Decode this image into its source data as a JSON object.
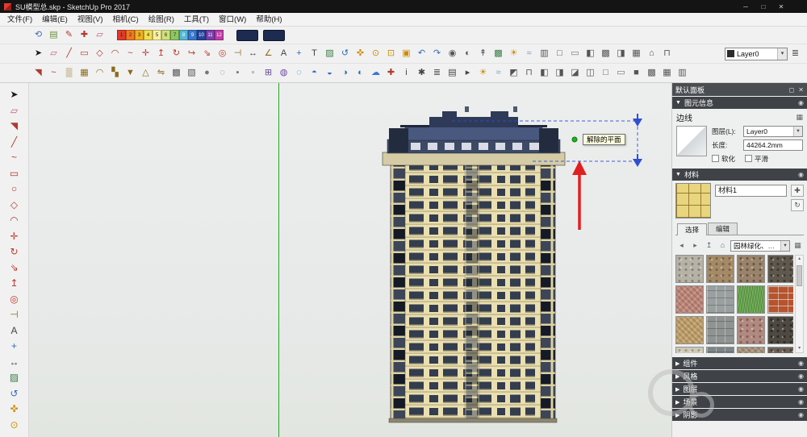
{
  "window": {
    "title": "SU模型总.skp - SketchUp Pro 2017",
    "controls": {
      "min": "─",
      "max": "□",
      "close": "✕"
    }
  },
  "menu": {
    "items": [
      "文件(F)",
      "编辑(E)",
      "视图(V)",
      "相机(C)",
      "绘图(R)",
      "工具(T)",
      "窗口(W)",
      "帮助(H)"
    ]
  },
  "glyphs": {
    "tri_open": "▼",
    "tri_closed": "▶",
    "pin": "◉",
    "float": "◻",
    "close_small": "✕",
    "dd_arrow": "▾",
    "scroll_up": "▴",
    "scroll_down": "▾",
    "entity_btn": "▦"
  },
  "toolbars": {
    "row1": {
      "icons": [
        {
          "n": "camera-orbit-icon",
          "g": "⟲",
          "c": "#3a6fb0"
        },
        {
          "n": "image-export-icon",
          "g": "▤",
          "c": "#6a8f3a"
        },
        {
          "n": "curve-edit-icon",
          "g": "✎",
          "c": "#b03a2e"
        },
        {
          "n": "add-scene-icon",
          "g": "✚",
          "c": "#b03a2e"
        },
        {
          "n": "eraser-icon",
          "g": "▱",
          "c": "#c05a7a"
        }
      ],
      "palette": {
        "numbers": [
          "1",
          "2",
          "3",
          "4",
          "5",
          "6",
          "7",
          "8",
          "9",
          "10",
          "11",
          "12"
        ],
        "colors": [
          "#e03a2a",
          "#f07820",
          "#f0b020",
          "#f4de4e",
          "#f8f0a0",
          "#cfe07a",
          "#8cc860",
          "#53b8d8",
          "#3a78d0",
          "#27459c",
          "#7a3fb0",
          "#c23ba8"
        ]
      },
      "displays": [
        {
          "n": "timeline-display-a"
        },
        {
          "n": "timeline-display-b"
        }
      ]
    },
    "row2": {
      "icons": [
        {
          "n": "select-tool",
          "g": "➤",
          "c": "#1a1a1a"
        },
        {
          "n": "eraser-tool",
          "g": "▱",
          "c": "#c05a7a"
        },
        {
          "n": "line-tool",
          "g": "╱",
          "c": "#b03a2e"
        },
        {
          "n": "rectangle-tool",
          "g": "▭",
          "c": "#b03a2e"
        },
        {
          "n": "shapes-tool",
          "g": "◇",
          "c": "#b03a2e"
        },
        {
          "n": "arc-tool",
          "g": "◠",
          "c": "#b03a2e"
        },
        {
          "n": "freehand-tool",
          "g": "~",
          "c": "#b03a2e"
        },
        {
          "n": "move-tool",
          "g": "✛",
          "c": "#c0392b"
        },
        {
          "n": "push-pull-tool",
          "g": "↥",
          "c": "#c0392b"
        },
        {
          "n": "rotate-tool",
          "g": "↻",
          "c": "#c0392b"
        },
        {
          "n": "follow-me-tool",
          "g": "↪",
          "c": "#c0392b"
        },
        {
          "n": "scale-tool",
          "g": "⇘",
          "c": "#c0392b"
        },
        {
          "n": "offset-tool",
          "g": "◎",
          "c": "#c0392b"
        },
        {
          "n": "tape-measure-tool",
          "g": "⊣",
          "c": "#8a6d1a"
        },
        {
          "n": "dimension-tool",
          "g": "↔",
          "c": "#444444"
        },
        {
          "n": "protractor-tool",
          "g": "∠",
          "c": "#8a6d1a"
        },
        {
          "n": "text-tool",
          "g": "A",
          "c": "#444444"
        },
        {
          "n": "axes-tool",
          "g": "+",
          "c": "#2e6fbd"
        },
        {
          "n": "3d-text-tool",
          "g": "T",
          "c": "#444444"
        },
        {
          "n": "section-plane-tool",
          "g": "▨",
          "c": "#3a7d44"
        },
        {
          "n": "orbit-tool",
          "g": "↺",
          "c": "#2e6fbd"
        },
        {
          "n": "pan-tool",
          "g": "✜",
          "c": "#d08a00"
        },
        {
          "n": "zoom-tool",
          "g": "⊙",
          "c": "#d08a00"
        },
        {
          "n": "zoom-window-tool",
          "g": "⊡",
          "c": "#d08a00"
        },
        {
          "n": "zoom-extents-tool",
          "g": "▣",
          "c": "#d08a00"
        },
        {
          "n": "previous-view-icon",
          "g": "↶",
          "c": "#2e6fbd"
        },
        {
          "n": "next-view-icon",
          "g": "↷",
          "c": "#2e6fbd"
        },
        {
          "n": "position-camera-tool",
          "g": "◉",
          "c": "#555555"
        },
        {
          "n": "look-around-tool",
          "g": "◐",
          "c": "#555555"
        },
        {
          "n": "walk-tool",
          "g": "↟",
          "c": "#555555"
        },
        {
          "n": "section-fill-toggle",
          "g": "▩",
          "c": "#3a7d44"
        },
        {
          "n": "shadows-toggle",
          "g": "☀",
          "c": "#d08a00"
        },
        {
          "n": "fog-toggle",
          "g": "≈",
          "c": "#7a9ab0"
        },
        {
          "n": "back-edges-toggle",
          "g": "▥",
          "c": "#555555"
        },
        {
          "n": "wireframe-style-icon",
          "g": "□",
          "c": "#555555"
        },
        {
          "n": "hidden-line-style-icon",
          "g": "▭",
          "c": "#777777"
        },
        {
          "n": "shaded-style-icon",
          "g": "◧",
          "c": "#555555"
        },
        {
          "n": "textured-style-icon",
          "g": "▩",
          "c": "#555555"
        },
        {
          "n": "monochrome-style-icon",
          "g": "◨",
          "c": "#555555"
        },
        {
          "n": "x-ray-style-icon",
          "g": "▦",
          "c": "#555555"
        },
        {
          "n": "iso-view-icon",
          "g": "⌂",
          "c": "#555555"
        },
        {
          "n": "top-view-icon",
          "g": "⊓",
          "c": "#555555"
        }
      ],
      "layer_dropdown": {
        "label": "Layer0"
      },
      "right_icons": [
        {
          "n": "layers-panel-icon",
          "g": "≣",
          "c": "#444444"
        }
      ]
    },
    "row3": {
      "icons": [
        {
          "n": "paint-bucket-tool",
          "g": "◥",
          "c": "#b03a2e"
        },
        {
          "n": "bezier-tool",
          "g": "~",
          "c": "#b03a2e"
        },
        {
          "n": "sandbox-from-contours-tool",
          "g": "▒",
          "c": "#8a6d1a"
        },
        {
          "n": "sandbox-from-scratch-tool",
          "g": "▦",
          "c": "#8a6d1a"
        },
        {
          "n": "smoove-tool",
          "g": "◠",
          "c": "#8a6d1a"
        },
        {
          "n": "stamp-tool",
          "g": "▚",
          "c": "#8a6d1a"
        },
        {
          "n": "drape-tool",
          "g": "▼",
          "c": "#8a6d1a"
        },
        {
          "n": "add-detail-tool",
          "g": "△",
          "c": "#8a6d1a"
        },
        {
          "n": "flip-edge-tool",
          "g": "⇋",
          "c": "#8a6d1a"
        },
        {
          "n": "position-texture-tool",
          "g": "▩",
          "c": "#555555"
        },
        {
          "n": "match-photo-icon",
          "g": "▧",
          "c": "#555555"
        },
        {
          "n": "hide-icon",
          "g": "●",
          "c": "#777777"
        },
        {
          "n": "unhide-icon",
          "g": "◌",
          "c": "#777777"
        },
        {
          "n": "lock-icon",
          "g": "▪",
          "c": "#777777"
        },
        {
          "n": "unlock-icon",
          "g": "▫",
          "c": "#777777"
        },
        {
          "n": "make-component-tool",
          "g": "⊞",
          "c": "#6a4aa0"
        },
        {
          "n": "make-group-tool",
          "g": "◍",
          "c": "#6a4aa0"
        },
        {
          "n": "outer-shell-tool",
          "g": "◌",
          "c": "#2e6fbd"
        },
        {
          "n": "solid-union-tool",
          "g": "◓",
          "c": "#2e6fbd"
        },
        {
          "n": "solid-subtract-tool",
          "g": "◒",
          "c": "#2e6fbd"
        },
        {
          "n": "solid-trim-tool",
          "g": "◑",
          "c": "#2e6fbd"
        },
        {
          "n": "solid-intersect-tool",
          "g": "◐",
          "c": "#2e6fbd"
        },
        {
          "n": "warehouse-icon",
          "g": "☁",
          "c": "#3a78d0"
        },
        {
          "n": "extension-warehouse-icon",
          "g": "✚",
          "c": "#b03a2e"
        },
        {
          "n": "model-info-icon",
          "g": "i",
          "c": "#444444"
        },
        {
          "n": "preferences-icon",
          "g": "✱",
          "c": "#444444"
        },
        {
          "n": "layers-icon",
          "g": "≣",
          "c": "#444444"
        },
        {
          "n": "scenes-icon",
          "g": "▤",
          "c": "#444444"
        },
        {
          "n": "animation-play-icon",
          "g": "▸",
          "c": "#444444"
        },
        {
          "n": "shadows-dialog-icon",
          "g": "☀",
          "c": "#d08a00"
        },
        {
          "n": "fog-dialog-icon",
          "g": "≈",
          "c": "#7a9ab0"
        },
        {
          "n": "iso-view-icon",
          "g": "◩",
          "c": "#555555"
        },
        {
          "n": "top-view-icon",
          "g": "⊓",
          "c": "#555555"
        },
        {
          "n": "front-view-icon",
          "g": "◧",
          "c": "#555555"
        },
        {
          "n": "right-view-icon",
          "g": "◨",
          "c": "#555555"
        },
        {
          "n": "back-view-icon",
          "g": "◪",
          "c": "#555555"
        },
        {
          "n": "left-view-icon",
          "g": "◫",
          "c": "#555555"
        },
        {
          "n": "wireframe-style-icon",
          "g": "□",
          "c": "#555555"
        },
        {
          "n": "hidden-line-style-icon",
          "g": "▭",
          "c": "#777777"
        },
        {
          "n": "shaded-style-icon",
          "g": "■",
          "c": "#555555"
        },
        {
          "n": "textured-style-icon",
          "g": "▩",
          "c": "#555555"
        },
        {
          "n": "monochrome-style-icon",
          "g": "▦",
          "c": "#555555"
        },
        {
          "n": "x-ray-style-icon",
          "g": "▥",
          "c": "#555555"
        }
      ]
    },
    "left": {
      "icons": [
        {
          "n": "select-tool",
          "g": "➤",
          "c": "#1a1a1a"
        },
        {
          "n": "eraser-tool",
          "g": "▱",
          "c": "#c05a7a"
        },
        {
          "n": "paint-bucket-tool",
          "g": "◥",
          "c": "#b03a2e"
        },
        {
          "n": "line-tool",
          "g": "╱",
          "c": "#b03a2e"
        },
        {
          "n": "freehand-tool",
          "g": "~",
          "c": "#b03a2e"
        },
        {
          "n": "rectangle-tool",
          "g": "▭",
          "c": "#b03a2e"
        },
        {
          "n": "circle-tool",
          "g": "○",
          "c": "#b03a2e"
        },
        {
          "n": "polygon-tool",
          "g": "◇",
          "c": "#b03a2e"
        },
        {
          "n": "arc-tool",
          "g": "◠",
          "c": "#b03a2e"
        },
        {
          "n": "move-tool",
          "g": "✛",
          "c": "#c0392b"
        },
        {
          "n": "rotate-tool",
          "g": "↻",
          "c": "#c0392b"
        },
        {
          "n": "scale-tool",
          "g": "⇘",
          "c": "#c0392b"
        },
        {
          "n": "push-pull-tool",
          "g": "↥",
          "c": "#c0392b"
        },
        {
          "n": "offset-tool",
          "g": "◎",
          "c": "#c0392b"
        },
        {
          "n": "tape-measure-tool",
          "g": "⊣",
          "c": "#8a6d1a"
        },
        {
          "n": "text-tool",
          "g": "A",
          "c": "#444444"
        },
        {
          "n": "axes-tool",
          "g": "+",
          "c": "#2e6fbd"
        },
        {
          "n": "dimension-tool",
          "g": "↔",
          "c": "#444444"
        },
        {
          "n": "section-plane-tool",
          "g": "▨",
          "c": "#3a7d44"
        },
        {
          "n": "orbit-tool",
          "g": "↺",
          "c": "#2e6fbd"
        },
        {
          "n": "pan-tool",
          "g": "✜",
          "c": "#d08a00"
        },
        {
          "n": "zoom-tool",
          "g": "⊙",
          "c": "#d08a00"
        }
      ]
    }
  },
  "viewport": {
    "tooltip": "解除的平面"
  },
  "panel": {
    "title": "默认面板",
    "entity": {
      "header": "图元信息",
      "kind": "边线",
      "layer_label": "图层(L):",
      "layer_value": "Layer0",
      "length_label": "长度:",
      "length_value": "44264.2mm",
      "soften": "软化",
      "smooth": "平滑"
    },
    "materials": {
      "header": "材料",
      "name": "材料1",
      "tabs": {
        "select": "选择",
        "edit": "编辑"
      },
      "dropdown": "园林绿化、地被层和...",
      "nav": [
        {
          "n": "back-icon",
          "g": "◂"
        },
        {
          "n": "forward-icon",
          "g": "▸"
        },
        {
          "n": "parent-folder-icon",
          "g": "↥"
        },
        {
          "n": "home-icon",
          "g": "⌂"
        }
      ],
      "nav_trailing": [
        {
          "n": "view-options-icon",
          "g": "▦"
        }
      ],
      "side": [
        {
          "n": "create-material-button",
          "g": "✚"
        },
        {
          "n": "sample-paint-button",
          "g": "↻"
        }
      ],
      "swatches": [
        {
          "kind": "pebble",
          "base": "#b7b2a6",
          "dot": "#8a857a"
        },
        {
          "kind": "pebble",
          "base": "#a58a68",
          "dot": "#7c6548"
        },
        {
          "kind": "pebble",
          "base": "#99836b",
          "dot": "#6b5844"
        },
        {
          "kind": "pebble",
          "base": "#5f584e",
          "dot": "#3e3931"
        },
        {
          "kind": "rough",
          "base": "#c08678",
          "dot": "#9a6456"
        },
        {
          "kind": "stone",
          "base": "#9aa0a0",
          "dot": "#767d7d"
        },
        {
          "kind": "grass",
          "base": "#69a84f",
          "dot": "#4e8a3a"
        },
        {
          "kind": "brick",
          "base": "#b5542e",
          "dot": "#8e3f20"
        },
        {
          "kind": "rough",
          "base": "#c2a06a",
          "dot": "#9a7b4c"
        },
        {
          "kind": "stone",
          "base": "#8f9392",
          "dot": "#6f7473"
        },
        {
          "kind": "pebble",
          "base": "#b08a80",
          "dot": "#876156"
        },
        {
          "kind": "pebble",
          "base": "#4e4a42",
          "dot": "#2f2c26"
        },
        {
          "kind": "pebble",
          "base": "#cfc9b8",
          "dot": "#a39d8c"
        },
        {
          "kind": "stone",
          "base": "#7d8588",
          "dot": "#5d6568"
        },
        {
          "kind": "rough",
          "base": "#a8937a",
          "dot": "#83705a"
        },
        {
          "kind": "pebble",
          "base": "#6d6257",
          "dot": "#4a423a"
        }
      ]
    },
    "collapsed": [
      {
        "key": "components",
        "label": "组件"
      },
      {
        "key": "styles",
        "label": "风格"
      },
      {
        "key": "layers",
        "label": "图层"
      },
      {
        "key": "scenes",
        "label": "场景"
      },
      {
        "key": "shadows",
        "label": "阴影"
      }
    ]
  }
}
